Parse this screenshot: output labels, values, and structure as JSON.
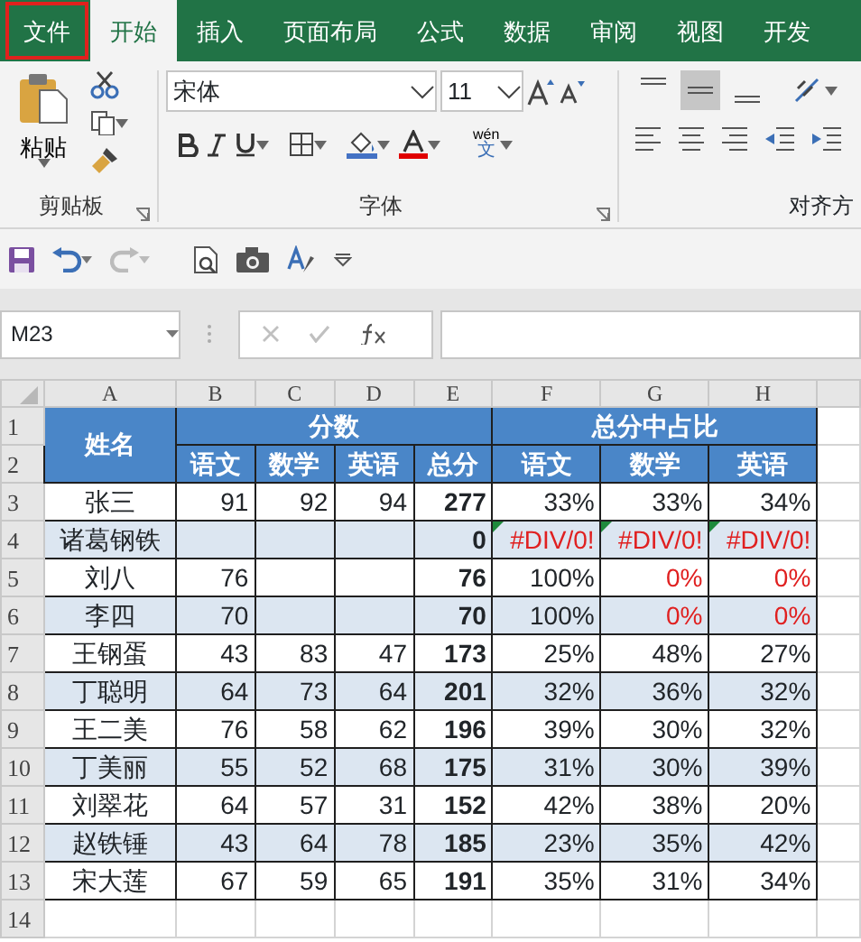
{
  "ribbon_tabs": {
    "file": {
      "label": "文件",
      "highlighted": true
    },
    "tabs": [
      {
        "label": "开始",
        "selected": true
      },
      {
        "label": "插入",
        "selected": false
      },
      {
        "label": "页面布局",
        "selected": false
      },
      {
        "label": "公式",
        "selected": false
      },
      {
        "label": "数据",
        "selected": false
      },
      {
        "label": "审阅",
        "selected": false
      },
      {
        "label": "视图",
        "selected": false
      },
      {
        "label": "开发",
        "selected": false
      }
    ]
  },
  "clipboard": {
    "paste": "粘贴",
    "group_label": "剪贴板"
  },
  "font": {
    "name": "宋体",
    "size": "11",
    "phonetic": "wén",
    "phonetic_char": "文",
    "group_label": "字体"
  },
  "alignment": {
    "group_label": "对齐方",
    "vertical": [
      {
        "selected": false
      },
      {
        "selected": true
      },
      {
        "selected": false
      }
    ]
  },
  "name_box": "M23",
  "sheet": {
    "column_letters": [
      "A",
      "B",
      "C",
      "D",
      "E",
      "F",
      "G",
      "H"
    ],
    "header_row_numbers": [
      "1",
      "2"
    ],
    "header": {
      "name": "姓名",
      "scores": "分数",
      "ratio": "总分中占比",
      "score_subjects": [
        "语文",
        "数学",
        "英语",
        "总分"
      ],
      "ratio_subjects": [
        "语文",
        "数学",
        "英语"
      ]
    },
    "rows": [
      {
        "number": "3",
        "name": "张三",
        "shaded": false,
        "scores": {
          "chinese": "91",
          "math": "92",
          "english": "94"
        },
        "total": "277",
        "ratios": [
          {
            "text": "33%",
            "alert": false,
            "flag": false
          },
          {
            "text": "33%",
            "alert": false,
            "flag": false
          },
          {
            "text": "34%",
            "alert": false,
            "flag": false
          }
        ]
      },
      {
        "number": "4",
        "name": "诸葛钢铁",
        "shaded": true,
        "scores": {},
        "total": "0",
        "ratios": [
          {
            "text": "#DIV/0!",
            "alert": true,
            "flag": true
          },
          {
            "text": "#DIV/0!",
            "alert": true,
            "flag": true
          },
          {
            "text": "#DIV/0!",
            "alert": true,
            "flag": true
          }
        ]
      },
      {
        "number": "5",
        "name": "刘八",
        "shaded": false,
        "scores": {
          "chinese": "76"
        },
        "total": "76",
        "ratios": [
          {
            "text": "100%",
            "alert": false,
            "flag": false
          },
          {
            "text": "0%",
            "alert": true,
            "flag": false
          },
          {
            "text": "0%",
            "alert": true,
            "flag": false
          }
        ]
      },
      {
        "number": "6",
        "name": "李四",
        "shaded": true,
        "scores": {
          "chinese": "70"
        },
        "total": "70",
        "ratios": [
          {
            "text": "100%",
            "alert": false,
            "flag": false
          },
          {
            "text": "0%",
            "alert": true,
            "flag": false
          },
          {
            "text": "0%",
            "alert": true,
            "flag": false
          }
        ]
      },
      {
        "number": "7",
        "name": "王钢蛋",
        "shaded": false,
        "scores": {
          "chinese": "43",
          "math": "83",
          "english": "47"
        },
        "total": "173",
        "ratios": [
          {
            "text": "25%",
            "alert": false,
            "flag": false
          },
          {
            "text": "48%",
            "alert": false,
            "flag": false
          },
          {
            "text": "27%",
            "alert": false,
            "flag": false
          }
        ]
      },
      {
        "number": "8",
        "name": "丁聪明",
        "shaded": true,
        "scores": {
          "chinese": "64",
          "math": "73",
          "english": "64"
        },
        "total": "201",
        "ratios": [
          {
            "text": "32%",
            "alert": false,
            "flag": false
          },
          {
            "text": "36%",
            "alert": false,
            "flag": false
          },
          {
            "text": "32%",
            "alert": false,
            "flag": false
          }
        ]
      },
      {
        "number": "9",
        "name": "王二美",
        "shaded": false,
        "scores": {
          "chinese": "76",
          "math": "58",
          "english": "62"
        },
        "total": "196",
        "ratios": [
          {
            "text": "39%",
            "alert": false,
            "flag": false
          },
          {
            "text": "30%",
            "alert": false,
            "flag": false
          },
          {
            "text": "32%",
            "alert": false,
            "flag": false
          }
        ]
      },
      {
        "number": "10",
        "name": "丁美丽",
        "shaded": true,
        "scores": {
          "chinese": "55",
          "math": "52",
          "english": "68"
        },
        "total": "175",
        "ratios": [
          {
            "text": "31%",
            "alert": false,
            "flag": false
          },
          {
            "text": "30%",
            "alert": false,
            "flag": false
          },
          {
            "text": "39%",
            "alert": false,
            "flag": false
          }
        ]
      },
      {
        "number": "11",
        "name": "刘翠花",
        "shaded": false,
        "scores": {
          "chinese": "64",
          "math": "57",
          "english": "31"
        },
        "total": "152",
        "ratios": [
          {
            "text": "42%",
            "alert": false,
            "flag": false
          },
          {
            "text": "38%",
            "alert": false,
            "flag": false
          },
          {
            "text": "20%",
            "alert": false,
            "flag": false
          }
        ]
      },
      {
        "number": "12",
        "name": "赵铁锤",
        "shaded": true,
        "scores": {
          "chinese": "43",
          "math": "64",
          "english": "78"
        },
        "total": "185",
        "ratios": [
          {
            "text": "23%",
            "alert": false,
            "flag": false
          },
          {
            "text": "35%",
            "alert": false,
            "flag": false
          },
          {
            "text": "42%",
            "alert": false,
            "flag": false
          }
        ]
      },
      {
        "number": "13",
        "name": "宋大莲",
        "shaded": false,
        "scores": {
          "chinese": "67",
          "math": "59",
          "english": "65"
        },
        "total": "191",
        "ratios": [
          {
            "text": "35%",
            "alert": false,
            "flag": false
          },
          {
            "text": "31%",
            "alert": false,
            "flag": false
          },
          {
            "text": "34%",
            "alert": false,
            "flag": false
          }
        ]
      }
    ],
    "next_row_number": "14"
  }
}
